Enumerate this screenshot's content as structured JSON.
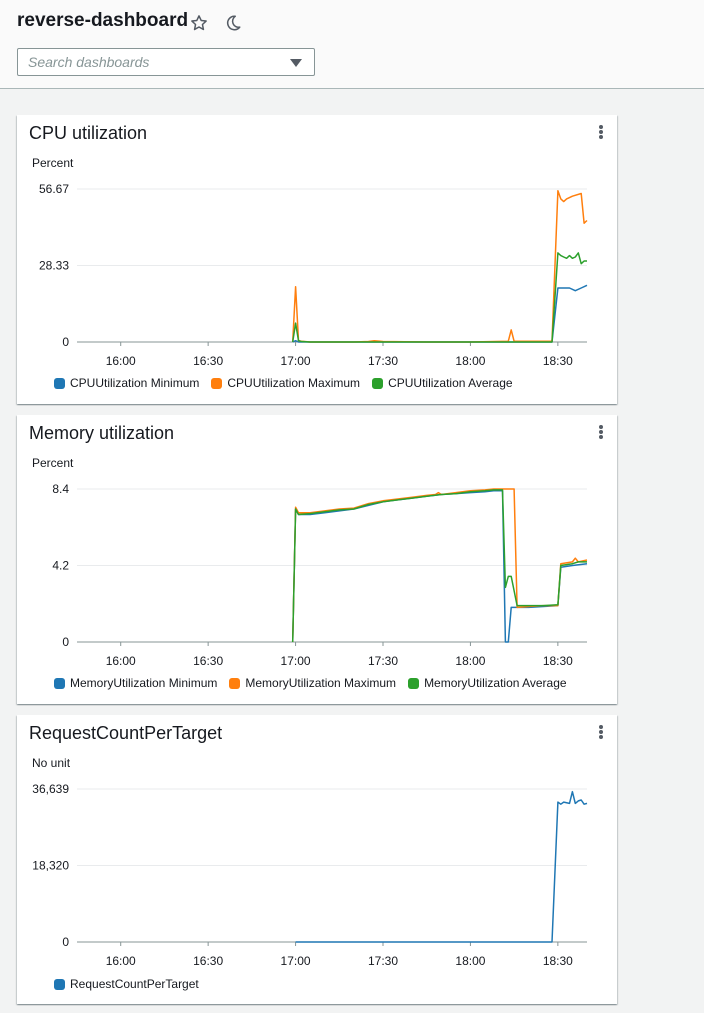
{
  "header": {
    "title": "reverse-dashboard",
    "favorite_icon": "star-icon",
    "theme_icon": "moon-icon",
    "search_placeholder": "Search dashboards",
    "search_value": ""
  },
  "colors": {
    "minimum": "#1f77b4",
    "maximum": "#ff7f0e",
    "average": "#2ca02c",
    "single": "#1f77b4"
  },
  "widgets": [
    {
      "title": "CPU utilization",
      "unit": "Percent",
      "legend": [
        "CPUUtilization Minimum",
        "CPUUtilization Maximum",
        "CPUUtilization Average"
      ]
    },
    {
      "title": "Memory utilization",
      "unit": "Percent",
      "legend": [
        "MemoryUtilization Minimum",
        "MemoryUtilization Maximum",
        "MemoryUtilization Average"
      ]
    },
    {
      "title": "RequestCountPerTarget",
      "unit": "No unit",
      "legend": [
        "RequestCountPerTarget"
      ]
    }
  ],
  "chart_data": [
    {
      "type": "line",
      "title": "CPU utilization",
      "ylabel": "Percent",
      "ylim": [
        0,
        56.67
      ],
      "y_ticks": [
        {
          "value": 0,
          "label": "0"
        },
        {
          "value": 28.33,
          "label": "28.33"
        },
        {
          "value": 56.67,
          "label": "56.67"
        }
      ],
      "xlim": [
        "15:45",
        "18:40"
      ],
      "x_ticks": [
        "16:00",
        "16:30",
        "17:00",
        "17:30",
        "18:00",
        "18:30"
      ],
      "grid": true,
      "legend_position": "bottom",
      "series": [
        {
          "name": "CPUUtilization Minimum",
          "color_key": "minimum",
          "x": [
            "16:59",
            "17:00",
            "17:01",
            "17:05",
            "17:30",
            "17:45",
            "18:00",
            "18:10",
            "18:20",
            "18:28",
            "18:30",
            "18:32",
            "18:34",
            "18:36",
            "18:38",
            "18:40"
          ],
          "y": [
            0,
            0.5,
            0,
            0,
            0,
            0,
            0,
            0,
            0,
            0,
            20,
            20,
            20,
            19,
            20,
            21
          ]
        },
        {
          "name": "CPUUtilization Maximum",
          "color_key": "maximum",
          "x": [
            "16:59",
            "17:00",
            "17:01",
            "17:02",
            "17:05",
            "17:20",
            "17:25",
            "17:27",
            "17:30",
            "17:45",
            "18:00",
            "18:13",
            "18:14",
            "18:15",
            "18:20",
            "18:28",
            "18:30",
            "18:31",
            "18:32",
            "18:33",
            "18:35",
            "18:38",
            "18:39",
            "18:40"
          ],
          "y": [
            0,
            20.5,
            0.5,
            0.3,
            0,
            0,
            0.2,
            0.5,
            0.2,
            0,
            0,
            0.3,
            4.5,
            0.3,
            0.3,
            0.3,
            56,
            53,
            52,
            53,
            54,
            55,
            44,
            45
          ]
        },
        {
          "name": "CPUUtilization Average",
          "color_key": "average",
          "x": [
            "16:59",
            "17:00",
            "17:01",
            "17:02",
            "17:05",
            "17:30",
            "17:45",
            "18:00",
            "18:10",
            "18:28",
            "18:30",
            "18:31",
            "18:32",
            "18:33",
            "18:34",
            "18:35",
            "18:36",
            "18:37",
            "18:38",
            "18:39",
            "18:40"
          ],
          "y": [
            0,
            7,
            0.5,
            0.2,
            0,
            0,
            0,
            0,
            0,
            0,
            33,
            32,
            31.5,
            31,
            32,
            31,
            31.5,
            33,
            29,
            30,
            30
          ]
        }
      ]
    },
    {
      "type": "line",
      "title": "Memory utilization",
      "ylabel": "Percent",
      "ylim": [
        0,
        8.4
      ],
      "y_ticks": [
        {
          "value": 0,
          "label": "0"
        },
        {
          "value": 4.2,
          "label": "4.2"
        },
        {
          "value": 8.4,
          "label": "8.4"
        }
      ],
      "xlim": [
        "15:45",
        "18:40"
      ],
      "x_ticks": [
        "16:00",
        "16:30",
        "17:00",
        "17:30",
        "18:00",
        "18:30"
      ],
      "grid": true,
      "legend_position": "bottom",
      "series": [
        {
          "name": "MemoryUtilization Minimum",
          "color_key": "minimum",
          "x": [
            "16:59",
            "17:00",
            "17:01",
            "17:05",
            "17:10",
            "17:15",
            "17:20",
            "17:25",
            "17:30",
            "17:35",
            "17:40",
            "17:45",
            "17:50",
            "17:55",
            "18:00",
            "18:05",
            "18:08",
            "18:11",
            "18:12",
            "18:13",
            "18:14",
            "18:16",
            "18:20",
            "18:25",
            "18:30",
            "18:31",
            "18:35",
            "18:40"
          ],
          "y": [
            0,
            7.3,
            7.0,
            7.0,
            7.1,
            7.2,
            7.3,
            7.5,
            7.7,
            7.8,
            7.9,
            8.0,
            8.1,
            8.15,
            8.2,
            8.25,
            8.3,
            8.3,
            0,
            0,
            1.9,
            1.9,
            1.9,
            1.95,
            2.0,
            4.1,
            4.2,
            4.3
          ]
        },
        {
          "name": "MemoryUtilization Maximum",
          "color_key": "maximum",
          "x": [
            "16:59",
            "17:00",
            "17:01",
            "17:05",
            "17:10",
            "17:15",
            "17:20",
            "17:25",
            "17:30",
            "17:35",
            "17:40",
            "17:45",
            "17:48",
            "17:49",
            "17:50",
            "17:55",
            "18:00",
            "18:05",
            "18:08",
            "18:11",
            "18:15",
            "18:16",
            "18:20",
            "18:25",
            "18:30",
            "18:31",
            "18:35",
            "18:36",
            "18:37",
            "18:40"
          ],
          "y": [
            0,
            7.4,
            7.1,
            7.1,
            7.2,
            7.3,
            7.35,
            7.6,
            7.75,
            7.85,
            7.95,
            8.05,
            8.1,
            8.2,
            8.1,
            8.2,
            8.3,
            8.35,
            8.4,
            8.4,
            8.4,
            1.9,
            1.95,
            2.0,
            2.0,
            4.3,
            4.4,
            4.6,
            4.4,
            4.5
          ]
        },
        {
          "name": "MemoryUtilization Average",
          "color_key": "average",
          "x": [
            "16:59",
            "17:00",
            "17:01",
            "17:05",
            "17:10",
            "17:15",
            "17:20",
            "17:25",
            "17:30",
            "17:35",
            "17:40",
            "17:45",
            "17:50",
            "17:55",
            "18:00",
            "18:05",
            "18:08",
            "18:11",
            "18:12",
            "18:13",
            "18:14",
            "18:16",
            "18:20",
            "18:25",
            "18:30",
            "18:31",
            "18:35",
            "18:37",
            "18:40"
          ],
          "y": [
            0,
            7.3,
            7.0,
            7.05,
            7.15,
            7.25,
            7.3,
            7.55,
            7.7,
            7.8,
            7.9,
            8.0,
            8.1,
            8.15,
            8.25,
            8.3,
            8.35,
            8.35,
            3.0,
            3.6,
            3.6,
            2.0,
            2.0,
            2.0,
            2.05,
            4.2,
            4.3,
            4.4,
            4.4
          ]
        }
      ]
    },
    {
      "type": "line",
      "title": "RequestCountPerTarget",
      "ylabel": "No unit",
      "ylim": [
        0,
        36639
      ],
      "y_ticks": [
        {
          "value": 0,
          "label": "0"
        },
        {
          "value": 18320,
          "label": "18,320"
        },
        {
          "value": 36639,
          "label": "36,639"
        }
      ],
      "xlim": [
        "15:45",
        "18:40"
      ],
      "x_ticks": [
        "16:00",
        "16:30",
        "17:00",
        "17:30",
        "18:00",
        "18:30"
      ],
      "grid": true,
      "legend_position": "bottom",
      "series": [
        {
          "name": "RequestCountPerTarget",
          "color_key": "single",
          "x": [
            "17:00",
            "17:30",
            "18:00",
            "18:15",
            "18:28",
            "18:30",
            "18:31",
            "18:32",
            "18:34",
            "18:35",
            "18:36",
            "18:37",
            "18:38",
            "18:39",
            "18:40"
          ],
          "y": [
            0,
            0,
            0,
            0,
            0,
            33500,
            33000,
            33500,
            33200,
            36000,
            33200,
            33800,
            34000,
            33000,
            33200
          ]
        }
      ]
    }
  ]
}
